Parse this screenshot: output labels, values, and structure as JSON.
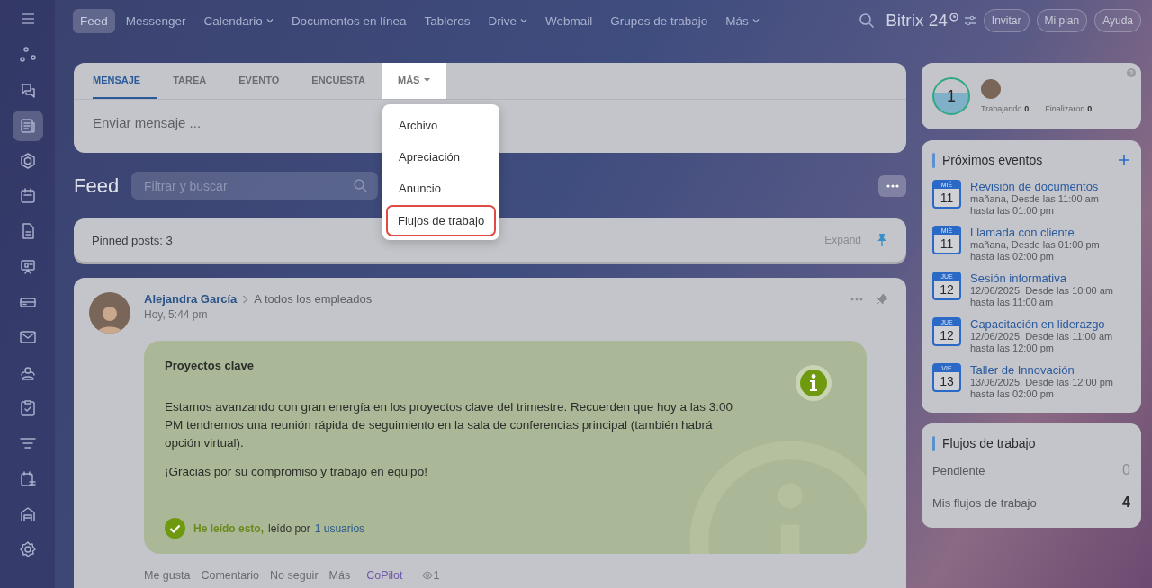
{
  "sidebar": {
    "items": [
      {
        "kind": "flow",
        "selected": false
      },
      {
        "kind": "chat",
        "selected": false
      },
      {
        "kind": "news",
        "selected": true
      },
      {
        "kind": "hexagon",
        "selected": false
      },
      {
        "kind": "calendar",
        "selected": false
      },
      {
        "kind": "document",
        "selected": false
      },
      {
        "kind": "board",
        "selected": false
      },
      {
        "kind": "drive",
        "selected": false
      },
      {
        "kind": "mail",
        "selected": false
      },
      {
        "kind": "people",
        "selected": false
      },
      {
        "kind": "task",
        "selected": false
      },
      {
        "kind": "funnel",
        "selected": false
      },
      {
        "kind": "schedule",
        "selected": false
      },
      {
        "kind": "store",
        "selected": false
      },
      {
        "kind": "settings",
        "selected": false
      }
    ]
  },
  "top_nav": {
    "items": [
      {
        "label": "Feed",
        "selected": true,
        "dropdown": false
      },
      {
        "label": "Messenger",
        "selected": false,
        "dropdown": false
      },
      {
        "label": "Calendario",
        "selected": false,
        "dropdown": true
      },
      {
        "label": "Documentos en línea",
        "selected": false,
        "dropdown": false
      },
      {
        "label": "Tableros",
        "selected": false,
        "dropdown": false
      },
      {
        "label": "Drive",
        "selected": false,
        "dropdown": true
      },
      {
        "label": "Webmail",
        "selected": false,
        "dropdown": false
      },
      {
        "label": "Grupos de trabajo",
        "selected": false,
        "dropdown": false
      },
      {
        "label": "Más",
        "selected": false,
        "dropdown": true
      }
    ],
    "brand": "Bitrix 24",
    "buttons": [
      "Invitar",
      "Mi plan",
      "Ayuda"
    ]
  },
  "composer": {
    "tabs": [
      {
        "label": "MENSAJE",
        "selected": true,
        "open": false
      },
      {
        "label": "TAREA",
        "selected": false,
        "open": false
      },
      {
        "label": "EVENTO",
        "selected": false,
        "open": false
      },
      {
        "label": "ENCUESTA",
        "selected": false,
        "open": false
      },
      {
        "label": "MÁS",
        "selected": false,
        "open": true
      }
    ],
    "placeholder": "Enviar mensaje ...",
    "menu": [
      {
        "label": "Archivo",
        "selected": false
      },
      {
        "label": "Apreciación",
        "selected": false
      },
      {
        "label": "Anuncio",
        "selected": false
      },
      {
        "label": "Flujos de trabajo",
        "selected": true
      }
    ]
  },
  "feed": {
    "title": "Feed",
    "search_placeholder": "Filtrar y buscar",
    "pinned": "Pinned posts: 3",
    "expand": "Expand",
    "post": {
      "author": "Alejandra García",
      "recipient": "A todos los empleados",
      "time": "Hoy, 5:44 pm",
      "title": "Proyectos clave",
      "paragraphs": [
        "Estamos avanzando con gran energía en los proyectos clave del trimestre. Recuerden que hoy a las 3:00 PM tendremos una reunión rápida de seguimiento en la sala de conferencias principal (también habrá opción virtual).",
        "¡Gracias por su compromiso y trabajo en equipo!"
      ],
      "read_label": "He leído esto,",
      "read_by": "leído por",
      "read_users": "1 usuarios",
      "actions": [
        "Me gusta",
        "Comentario",
        "No seguir",
        "Más"
      ],
      "copilot": "CoPilot",
      "views": "1"
    }
  },
  "worktime": {
    "count": "1",
    "stats": [
      {
        "label": "Trabajando",
        "value": "0"
      },
      {
        "label": "Finalizaron",
        "value": "0"
      }
    ]
  },
  "events": {
    "title": "Próximos eventos",
    "items": [
      {
        "weekday": "MIÉ",
        "day": "11",
        "title": "Revisión de documentos",
        "when": "mañana, Desde las 11:00 am",
        "until": "hasta las 01:00 pm"
      },
      {
        "weekday": "MIÉ",
        "day": "11",
        "title": "Llamada con cliente",
        "when": "mañana, Desde las 01:00 pm",
        "until": "hasta las 02:00 pm"
      },
      {
        "weekday": "JUE",
        "day": "12",
        "title": "Sesión informativa",
        "when": "12/06/2025, Desde las 10:00 am",
        "until": "hasta las 11:00 am"
      },
      {
        "weekday": "JUE",
        "day": "12",
        "title": "Capacitación en liderazgo",
        "when": "12/06/2025, Desde las 11:00 am",
        "until": "hasta las 12:00 pm"
      },
      {
        "weekday": "VIE",
        "day": "13",
        "title": "Taller de Innovación",
        "when": "13/06/2025, Desde las 12:00 pm",
        "until": "hasta las 02:00 pm"
      }
    ]
  },
  "workflows": {
    "title": "Flujos de trabajo",
    "rows": [
      {
        "label": "Pendiente",
        "value": "0",
        "emphasis": false
      },
      {
        "label": "Mis flujos de trabajo",
        "value": "4",
        "emphasis": true
      }
    ]
  }
}
